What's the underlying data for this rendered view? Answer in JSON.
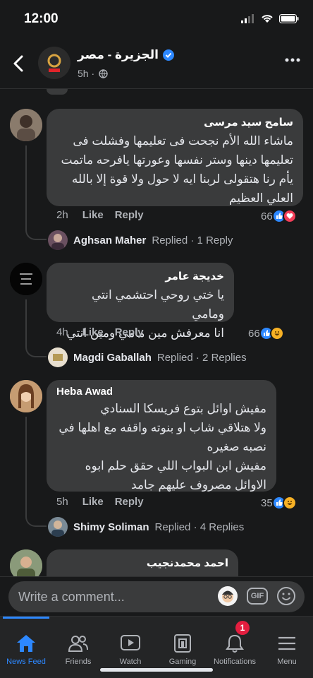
{
  "status_bar": {
    "time": "12:00"
  },
  "header": {
    "page_name": "الجزيرة - مصر",
    "meta": "5h ·"
  },
  "comments": [
    {
      "author": "سامح سيد مرسى",
      "lines": [
        "ماشاء الله الأم نجحت فى تعليمها وفشلت فى",
        "تعليمها دينها وستر نفسها وعورتها يافرحه ماتمت",
        "يأم رنا هتقولى لربنا ايه  لا حول ولا قوة إلا بالله",
        "العلي العظيم"
      ],
      "time": "2h",
      "like": "Like",
      "reply": "Reply",
      "react_count": "66",
      "reactions": [
        "like",
        "love"
      ],
      "replied_name": "Aghsan Maher",
      "replied_text": "Replied · 1 Reply"
    },
    {
      "author": "خديجة عامر",
      "lines": [
        "يا ختي روحي احتشمي انتي ومامي",
        "انا معرفش مين مامي ومين انتي"
      ],
      "time": "4h",
      "like": "Like",
      "reply": "Reply",
      "react_count": "66",
      "reactions": [
        "like",
        "haha"
      ],
      "replied_name": "Magdi Gaballah",
      "replied_text": "Replied · 2 Replies"
    },
    {
      "author": "Heba Awad",
      "lines": [
        "مفيش اوائل بتوع فريسكا السنادي",
        "ولا هتلاقي شاب او بنوته واقفه مع اهلها في",
        "نصبه صغيره",
        "مفيش ابن البواب اللي حقق حلم ابوه",
        "الاوائل مصروف عليهم جامد"
      ],
      "time": "5h",
      "like": "Like",
      "reply": "Reply",
      "react_count": "35",
      "reactions": [
        "like",
        "haha"
      ],
      "replied_name": "Shimy Soliman",
      "replied_text": "Replied · 4 Replies"
    },
    {
      "author": "احمد محمدنجيب"
    }
  ],
  "comment_bar": {
    "placeholder": "Write a comment...",
    "gif": "GIF"
  },
  "tabs": [
    {
      "label": "News Feed",
      "icon": "home-icon"
    },
    {
      "label": "Friends",
      "icon": "friends-icon"
    },
    {
      "label": "Watch",
      "icon": "watch-icon"
    },
    {
      "label": "Gaming",
      "icon": "gaming-icon"
    },
    {
      "label": "Notifications",
      "icon": "bell-icon",
      "badge": "1"
    },
    {
      "label": "Menu",
      "icon": "menu-icon"
    }
  ],
  "colors": {
    "accent": "#2d88ff",
    "bubble": "#3a3b3c",
    "background": "#18191a",
    "badge": "#e41e3f"
  }
}
